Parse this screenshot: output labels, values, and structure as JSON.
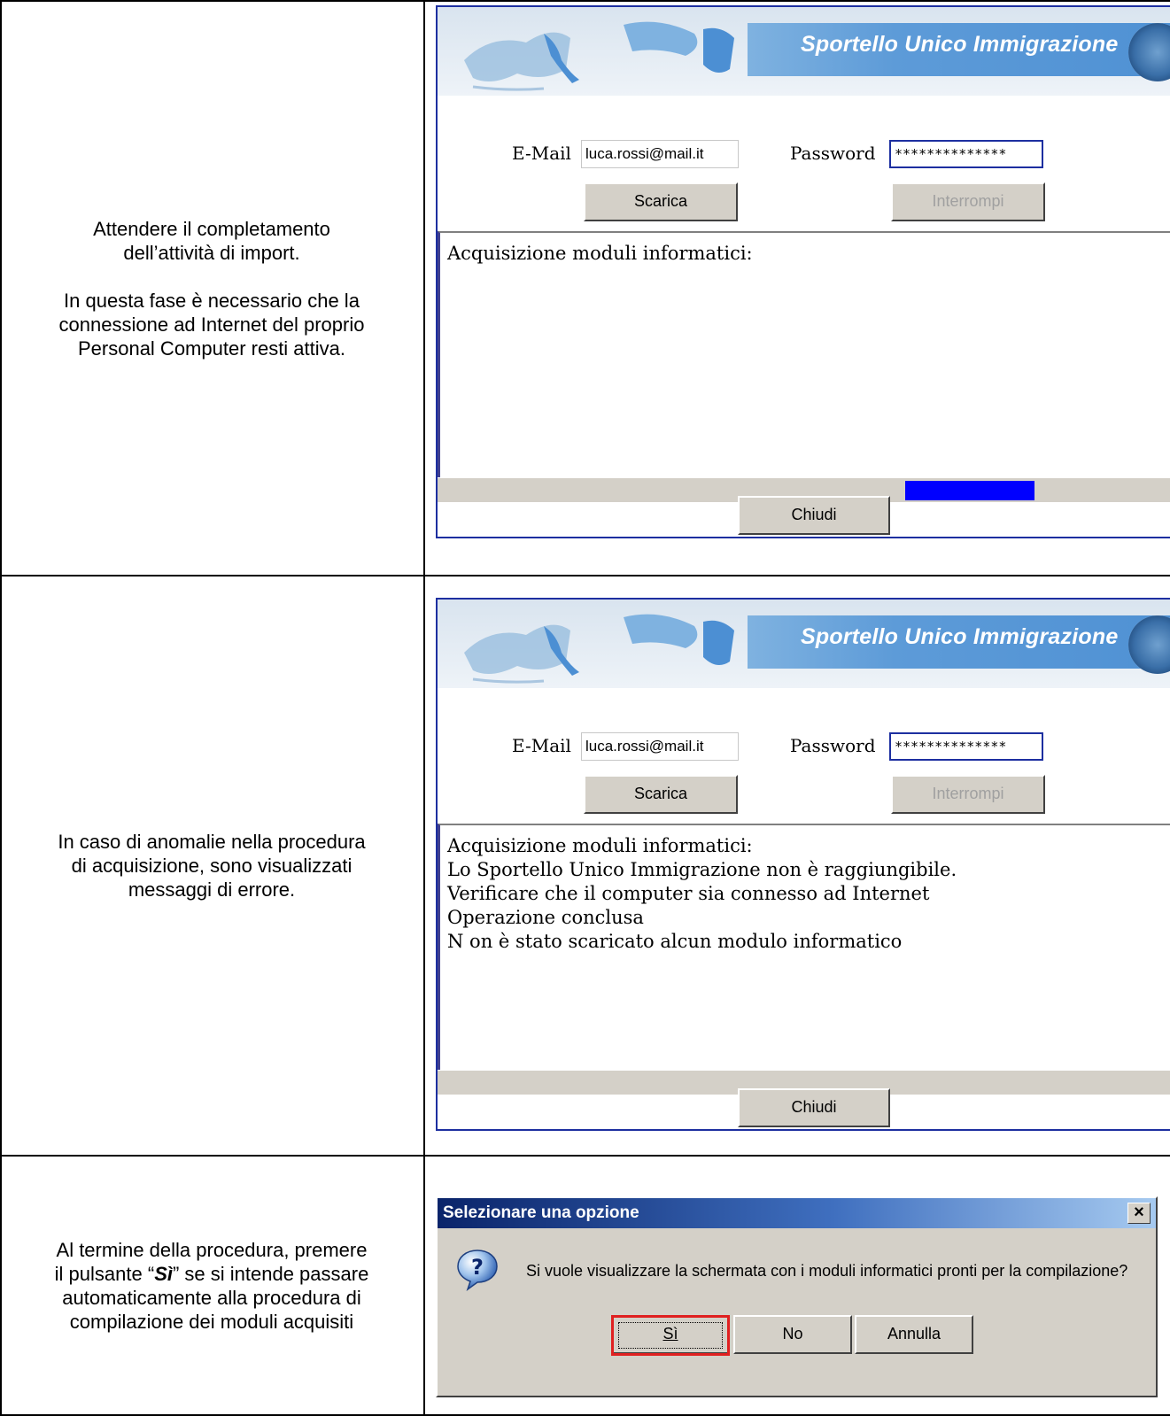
{
  "rows": [
    {
      "description": [
        "Attendere il completamento",
        "dell’attività di import.",
        "In questa fase è necessario che la",
        "connessione ad Internet del proprio",
        "Personal Computer resti attiva."
      ],
      "app": {
        "banner_title": "Sportello Unico Immigrazione",
        "email_label": "E-Mail",
        "email_value": "luca.rossi@mail.it",
        "password_label": "Password",
        "password_value": "**************",
        "download_button": "Scarica",
        "stop_button": "Interrompi",
        "log_lines": [
          "Acquisizione moduli informatici:"
        ],
        "progress_fraction": 0.18,
        "close_button": "Chiudi"
      }
    },
    {
      "description": [
        "In caso di anomalie nella procedura",
        "di acquisizione, sono visualizzati",
        "messaggi di errore."
      ],
      "app": {
        "banner_title": "Sportello Unico Immigrazione",
        "email_label": "E-Mail",
        "email_value": "luca.rossi@mail.it",
        "password_label": "Password",
        "password_value": "**************",
        "download_button": "Scarica",
        "stop_button": "Interrompi",
        "log_lines": [
          "Acquisizione moduli informatici:",
          "Lo Sportello Unico Immigrazione non è raggiungibile.",
          "Verificare che il computer sia connesso ad Internet",
          "Operazione conclusa",
          "N on è stato scaricato alcun modulo informatico"
        ],
        "close_button": "Chiudi"
      }
    },
    {
      "description": [
        "Al termine della procedura, premere",
        "il pulsante “",
        "Sì",
        "” se si intende passare",
        "automaticamente alla procedura di",
        "compilazione dei moduli acquisiti"
      ],
      "dialog": {
        "title": "Selezionare una opzione",
        "close_glyph": "×",
        "message": "Si vuole visualizzare la schermata con i moduli informatici pronti per la compilazione?",
        "yes_button": "Sì",
        "no_button": "No",
        "cancel_button": "Annulla",
        "icon": "question-icon"
      }
    }
  ]
}
